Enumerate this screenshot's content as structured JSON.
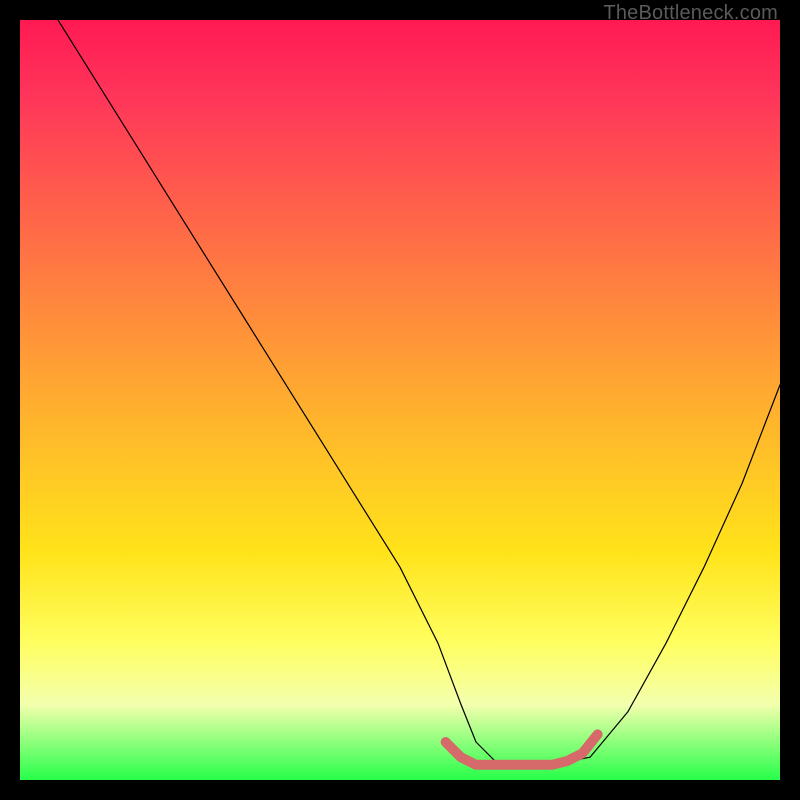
{
  "chart_data": {
    "type": "line",
    "title": "",
    "xlabel": "",
    "ylabel": "",
    "xlim": [
      0,
      100
    ],
    "ylim": [
      0,
      100
    ],
    "description": "Bottleneck curve: high on both ends, valley (optimum) near the middle-right; valley floor highlighted with a thick pinkish-red segment.",
    "grid": false,
    "legend": false,
    "series": [
      {
        "name": "bottleneck-curve",
        "x": [
          5,
          10,
          15,
          20,
          25,
          30,
          35,
          40,
          45,
          50,
          55,
          58,
          60,
          63,
          66,
          70,
          75,
          80,
          85,
          90,
          95,
          100
        ],
        "y": [
          100,
          92,
          84,
          76,
          68,
          60,
          52,
          44,
          36,
          28,
          18,
          10,
          5,
          2,
          2,
          2,
          3,
          9,
          18,
          28,
          39,
          52
        ],
        "stroke": "#000000",
        "stroke_width": 1.2
      },
      {
        "name": "optimum-highlight",
        "x": [
          56,
          58,
          60,
          62,
          64,
          66,
          68,
          70,
          72,
          74,
          76
        ],
        "y": [
          5,
          3,
          2,
          2,
          2,
          2,
          2,
          2,
          2.5,
          3.5,
          6
        ],
        "stroke": "#d66a6a",
        "stroke_width": 10
      }
    ]
  },
  "watermark": "TheBottleneck.com",
  "colors": {
    "page_bg": "#000000",
    "curve": "#000000",
    "highlight": "#d66a6a",
    "gradient_top": "#ff1a52",
    "gradient_bottom": "#26ff4a"
  }
}
